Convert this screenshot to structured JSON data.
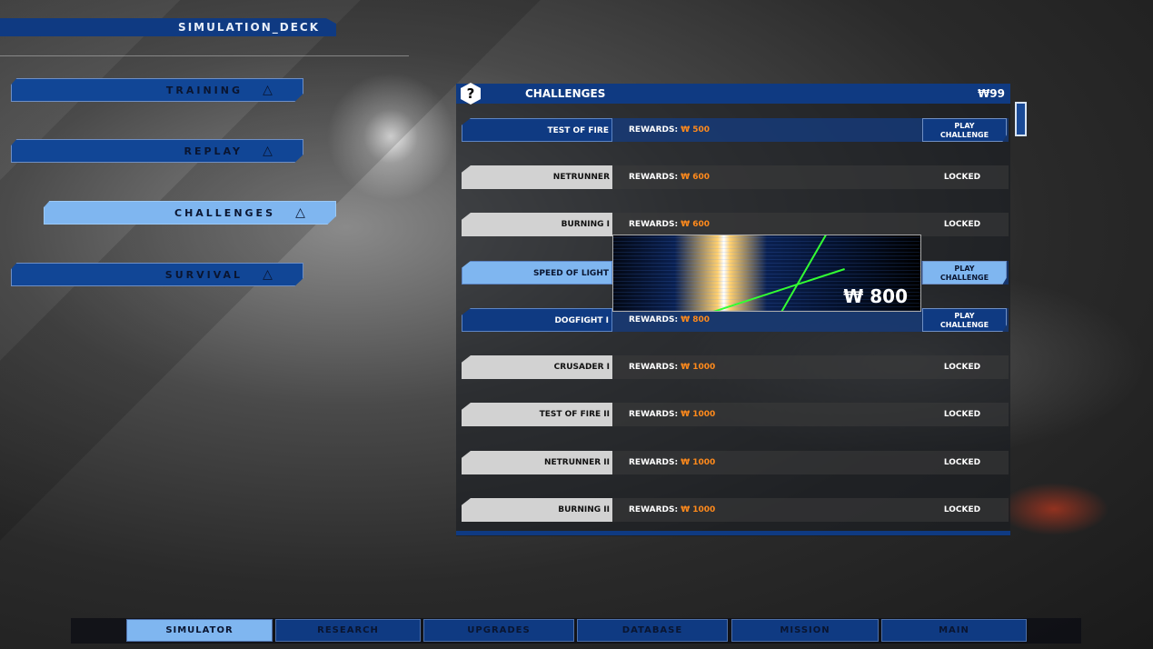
{
  "header": {
    "title": "SIMULATION_DECK"
  },
  "menu": [
    {
      "label": "TRAINING",
      "icon": "ship-icon"
    },
    {
      "label": "REPLAY",
      "icon": "ship-icon"
    },
    {
      "label": "CHALLENGES",
      "icon": "ship-icon",
      "active": true
    },
    {
      "label": "SURVIVAL",
      "icon": "ship-icon"
    }
  ],
  "panel": {
    "help": "?",
    "title": "CHALLENGES",
    "currency": "₩99"
  },
  "rewards_label": "REWARDS:",
  "currency_symbol": "₩",
  "challenges": [
    {
      "name": "TEST OF FIRE",
      "reward": "₩ 500",
      "status": "PLAY CHALLENGE"
    },
    {
      "name": "NETRUNNER",
      "reward": "₩ 600",
      "status": "LOCKED"
    },
    {
      "name": "BURNING I",
      "reward": "₩ 600",
      "status": "LOCKED"
    },
    {
      "name": "SPEED OF LIGHT",
      "reward": "₩ 800",
      "status": "PLAY CHALLENGE",
      "selected": true
    },
    {
      "name": "DOGFIGHT I",
      "reward": "₩ 800",
      "status": "PLAY CHALLENGE"
    },
    {
      "name": "CRUSADER I",
      "reward": "₩ 1000",
      "status": "LOCKED"
    },
    {
      "name": "TEST OF FIRE II",
      "reward": "₩ 1000",
      "status": "LOCKED"
    },
    {
      "name": "NETRUNNER II",
      "reward": "₩ 1000",
      "status": "LOCKED"
    },
    {
      "name": "BURNING II",
      "reward": "₩ 1000",
      "status": "LOCKED"
    }
  ],
  "preview": {
    "price": "₩ 800"
  },
  "play_label": {
    "line1": "PLAY",
    "line2": "CHALLENGE"
  },
  "tabs": [
    {
      "label": "SIMULATOR",
      "active": true
    },
    {
      "label": "RESEARCH"
    },
    {
      "label": "UPGRADES"
    },
    {
      "label": "DATABASE"
    },
    {
      "label": "MISSION"
    },
    {
      "label": "MAIN"
    }
  ],
  "colors": {
    "primary": "#0f3a82",
    "active": "#7fb6f0",
    "reward": "#ff8a1c"
  }
}
